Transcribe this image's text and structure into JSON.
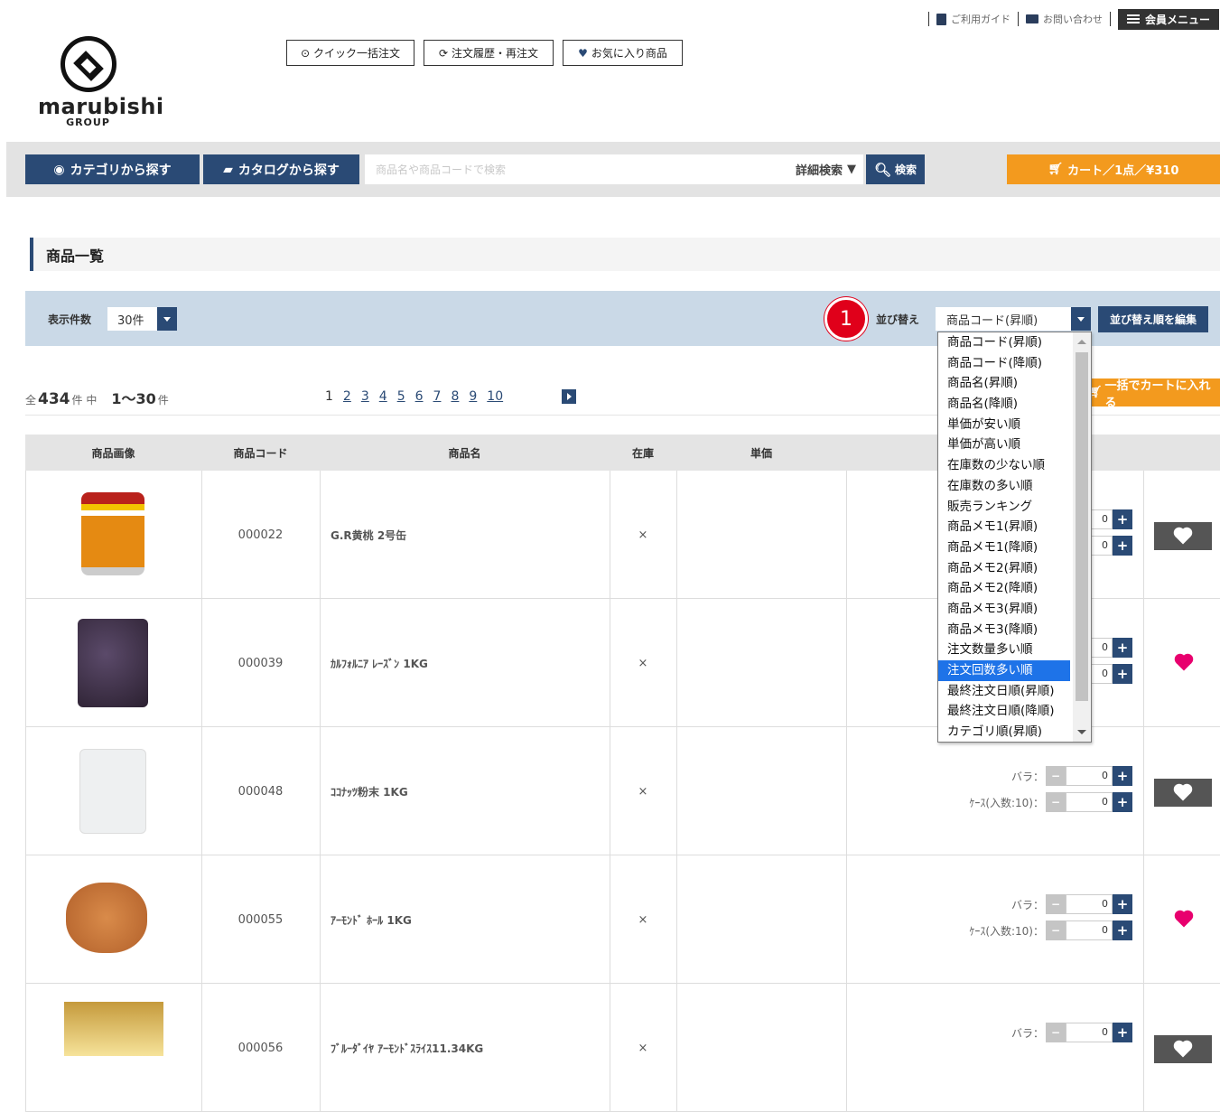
{
  "top_links": {
    "guide": "ご利用ガイド",
    "contact": "お問い合わせ",
    "member_menu": "会員メニュー"
  },
  "logo": {
    "name": "marubishi",
    "group": "GROUP"
  },
  "quick_buttons": {
    "quick_order": "クイック一括注文",
    "history": "注文履歴・再注文",
    "favorites": "お気に入り商品"
  },
  "nav": {
    "category": "カテゴリから探す",
    "catalog": "カタログから探す",
    "search_placeholder": "商品名や商品コードで検索",
    "advanced": "詳細検索",
    "search": "検索",
    "cart": "カート／1点／¥310"
  },
  "page_title": "商品一覧",
  "settings": {
    "per_page_label": "表示件数",
    "per_page_value": "30件",
    "sort_label": "並び替え",
    "sort_value": "商品コード(昇順)",
    "edit_sort": "並び替え順を編集",
    "callout": "1"
  },
  "sort_options": [
    "商品コード(昇順)",
    "商品コード(降順)",
    "商品名(昇順)",
    "商品名(降順)",
    "単価が安い順",
    "単価が高い順",
    "在庫数の少ない順",
    "在庫数の多い順",
    "販売ランキング",
    "商品メモ1(昇順)",
    "商品メモ1(降順)",
    "商品メモ2(昇順)",
    "商品メモ2(降順)",
    "商品メモ3(昇順)",
    "商品メモ3(降順)",
    "注文数量多い順",
    "注文回数多い順",
    "最終注文日順(昇順)",
    "最終注文日順(降順)",
    "カテゴリ順(昇順)"
  ],
  "highlighted_option": "注文回数多い順",
  "results": {
    "prefix": "全",
    "total": "434",
    "unit1": "件 中",
    "range": "1〜30",
    "unit2": "件"
  },
  "pagination": [
    "1",
    "2",
    "3",
    "4",
    "5",
    "6",
    "7",
    "8",
    "9",
    "10"
  ],
  "bulk_cart": "一括でカートに入れる",
  "columns": {
    "image": "商品画像",
    "code": "商品コード",
    "name": "商品名",
    "stock": "在庫",
    "price": "単価"
  },
  "rows": [
    {
      "code": "000022",
      "name": "G.R黄桃 2号缶",
      "stock": "×",
      "bara": "",
      "case": "",
      "q1": "0",
      "q2": "0",
      "fav": false
    },
    {
      "code": "000039",
      "name": "ｶﾙﾌｫﾙﾆｱ ﾚｰｽﾞﾝ 1KG",
      "stock": "×",
      "bara": "",
      "case": "",
      "q1": "0",
      "q2": "0",
      "fav": true
    },
    {
      "code": "000048",
      "name": "ｺｺﾅｯﾂ粉末 1KG",
      "stock": "×",
      "bara": "バラ：",
      "case": "ｹｰｽ(入数:10)：",
      "q1": "0",
      "q2": "0",
      "fav": false
    },
    {
      "code": "000055",
      "name": "ｱｰﾓﾝﾄﾞ ﾎｰﾙ 1KG",
      "stock": "×",
      "bara": "バラ：",
      "case": "ｹｰｽ(入数:10)：",
      "q1": "0",
      "q2": "0",
      "fav": true
    },
    {
      "code": "000056",
      "name": "ﾌﾞﾙｰﾀﾞｲﾔ ｱｰﾓﾝﾄﾞｽﾗｲｽ11.34KG",
      "stock": "×",
      "bara": "バラ：",
      "case": "",
      "q1": "0",
      "q2": "",
      "fav": false
    }
  ],
  "colors": {
    "navy": "#2a4a75",
    "orange": "#f39a1e",
    "badge": "#e0001a",
    "fav_pink": "#e8006e"
  }
}
